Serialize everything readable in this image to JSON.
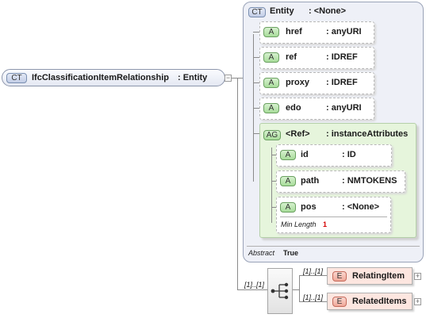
{
  "root": {
    "badge": "CT",
    "name": "IfcClassificationItemRelationship",
    "type": ": Entity"
  },
  "entity": {
    "badge": "CT",
    "name": "Entity",
    "type": ": <None>",
    "attributes": [
      {
        "badge": "A",
        "name": "href",
        "type": ": anyURI"
      },
      {
        "badge": "A",
        "name": "ref",
        "type": ": IDREF"
      },
      {
        "badge": "A",
        "name": "proxy",
        "type": ": IDREF"
      },
      {
        "badge": "A",
        "name": "edo",
        "type": ": anyURI"
      }
    ],
    "group": {
      "badge": "AG",
      "name": "<Ref>",
      "type": ": instanceAttributes",
      "attributes": [
        {
          "badge": "A",
          "name": "id",
          "type": ": ID"
        },
        {
          "badge": "A",
          "name": "path",
          "type": ": NMTOKENS"
        },
        {
          "badge": "A",
          "name": "pos",
          "type": ": <None>",
          "facet_label": "Min Length",
          "facet_value": "1"
        }
      ]
    },
    "abstract_label": "Abstract",
    "abstract_value": "True"
  },
  "sequence": {
    "multiplicity": "[1]..[1]",
    "elements": [
      {
        "badge": "E",
        "name": "RelatingItem",
        "multiplicity": "[1]..[1]"
      },
      {
        "badge": "E",
        "name": "RelatedItems",
        "multiplicity": "[1]..[1]"
      }
    ]
  },
  "colors": {
    "ct_panel": "#eef0f7",
    "ag_panel": "#e6f5dc",
    "element_fill": "#fde6e0",
    "facet_value": "#d40000"
  }
}
